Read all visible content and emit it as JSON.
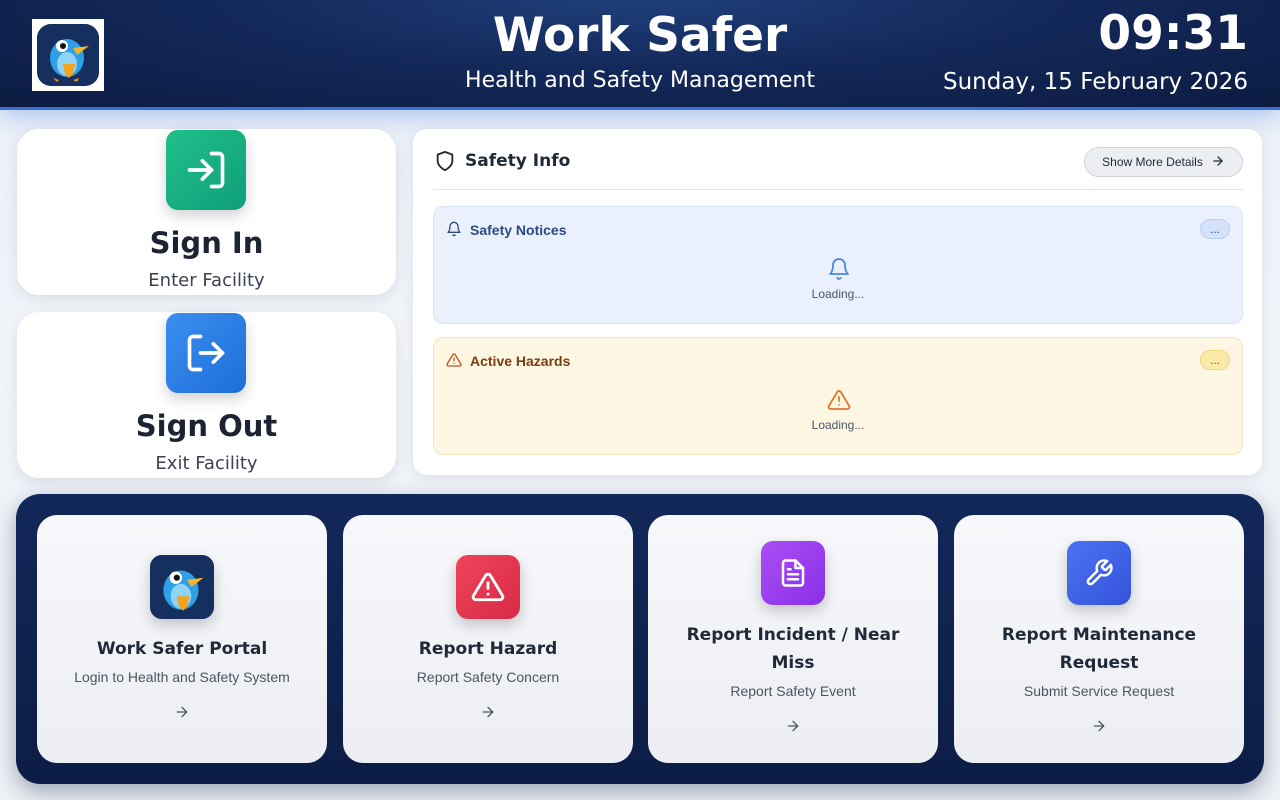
{
  "header": {
    "title": "Work Safer",
    "subtitle": "Health and Safety Management",
    "time": "09:31",
    "date": "Sunday, 15 February 2026"
  },
  "sign_in": {
    "label": "Sign In",
    "sub": "Enter Facility",
    "icon": "sign-in-icon",
    "color": "#1aaf84"
  },
  "sign_out": {
    "label": "Sign Out",
    "sub": "Exit Facility",
    "icon": "sign-out-icon",
    "color": "#2a7fe4"
  },
  "safety_info": {
    "title": "Safety Info",
    "more_button": "Show More Details",
    "notices": {
      "title": "Safety Notices",
      "badge": "...",
      "loading": "Loading..."
    },
    "hazards": {
      "title": "Active Hazards",
      "badge": "...",
      "loading": "Loading..."
    }
  },
  "tiles": [
    {
      "title": "Work Safer Portal",
      "sub": "Login to Health and Safety System",
      "icon": "bird-logo-icon"
    },
    {
      "title": "Report Hazard",
      "sub": "Report Safety Concern",
      "icon": "warning-triangle-icon",
      "color": "#e8364f"
    },
    {
      "title": "Report Incident / Near Miss",
      "sub": "Report Safety Event",
      "icon": "document-icon",
      "color": "#9b3ef0"
    },
    {
      "title": "Report Maintenance Request",
      "sub": "Submit Service Request",
      "icon": "wrench-icon",
      "color": "#3f63e6"
    }
  ]
}
